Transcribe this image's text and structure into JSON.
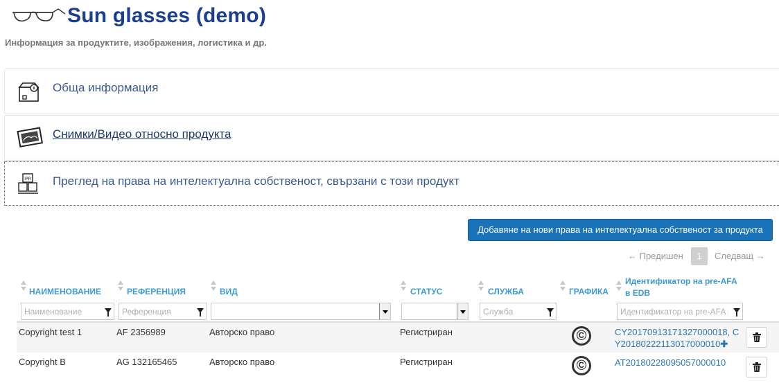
{
  "header": {
    "title": "Sun glasses (demo)",
    "subtitle": "Информация за продуктите, изображения, логистика и др.",
    "logo_icon": "glasses-icon"
  },
  "panels": [
    {
      "label": "Обща информация",
      "icon": "box-info-icon"
    },
    {
      "label": "Снимки/Видео относно продукта",
      "icon": "photos-icon"
    },
    {
      "label": "Преглед на права на интелектуална собственост, свързани с този продукт",
      "icon": "ipr-boxes-icon"
    }
  ],
  "actions": {
    "add_rights_label": "Добавяне на нови права на интелектуална собственост за продукта"
  },
  "pagination": {
    "prev_label": "← Предишен",
    "page": "1",
    "next_label": "Следващ →"
  },
  "table": {
    "columns": [
      {
        "label": "НАИМЕНОВАНИЕ",
        "filter_placeholder": "Наименование"
      },
      {
        "label": "РЕФЕРЕНЦИЯ",
        "filter_placeholder": "Референция"
      },
      {
        "label": "ВИД",
        "filter_placeholder": ""
      },
      {
        "label": "СТАТУС",
        "filter_placeholder": ""
      },
      {
        "label": "СЛУЖБА",
        "filter_placeholder": "Служба"
      },
      {
        "label": "ГРАФИКА",
        "filter_placeholder": ""
      },
      {
        "label_line1": "Идентификатор на pre-AFA",
        "label_line2": "в EDB",
        "filter_placeholder": "Идентификатор на pre-AFA в EDB"
      }
    ],
    "rows": [
      {
        "name": "Copyright test 1",
        "reference": "AF 2356989",
        "type": "Авторско право",
        "status": "Регистриран",
        "graphic": "©",
        "id_line1": "CY20170913171327000018, C",
        "id_line2": "Y20180222113017000010",
        "id_more": "✚"
      },
      {
        "name": "Copyright B",
        "reference": "AG 132165465",
        "type": "Авторско право",
        "status": "Регистриран",
        "graphic": "©",
        "id_line1": "AT20180228095057000010"
      }
    ]
  },
  "colors": {
    "title": "#1b3f8f",
    "accent_button": "#1a73b8",
    "header_text": "#3c9ad0",
    "link": "#2f76b3"
  }
}
